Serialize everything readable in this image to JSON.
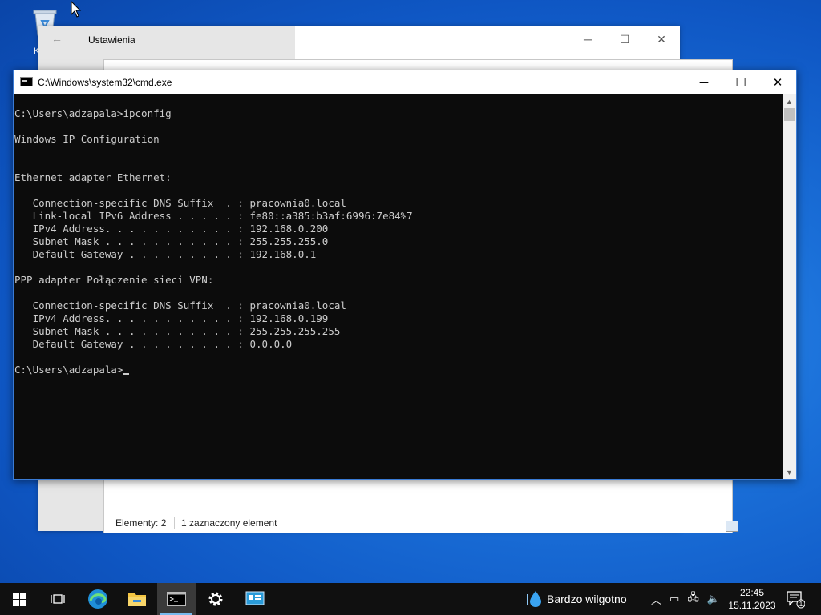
{
  "desktop": {
    "recycle_bin_label": "K"
  },
  "settings_window": {
    "title": "Ustawienia"
  },
  "explorer_window": {
    "status_items": "Elementy: 2",
    "status_selected": "1 zaznaczony element"
  },
  "cmd_window": {
    "title": "C:\\Windows\\system32\\cmd.exe",
    "lines": [
      "C:\\Users\\adzapala>ipconfig",
      "",
      "Windows IP Configuration",
      "",
      "",
      "Ethernet adapter Ethernet:",
      "",
      "   Connection-specific DNS Suffix  . : pracownia0.local",
      "   Link-local IPv6 Address . . . . . : fe80::a385:b3af:6996:7e84%7",
      "   IPv4 Address. . . . . . . . . . . : 192.168.0.200",
      "   Subnet Mask . . . . . . . . . . . : 255.255.255.0",
      "   Default Gateway . . . . . . . . . : 192.168.0.1",
      "",
      "PPP adapter Połączenie sieci VPN:",
      "",
      "   Connection-specific DNS Suffix  . : pracownia0.local",
      "   IPv4 Address. . . . . . . . . . . : 192.168.0.199",
      "   Subnet Mask . . . . . . . . . . . : 255.255.255.255",
      "   Default Gateway . . . . . . . . . : 0.0.0.0",
      "",
      "C:\\Users\\adzapala>"
    ]
  },
  "taskbar": {
    "weather_text": "Bardzo wilgotno",
    "time": "22:45",
    "date": "15.11.2023",
    "notification_count": "1"
  }
}
